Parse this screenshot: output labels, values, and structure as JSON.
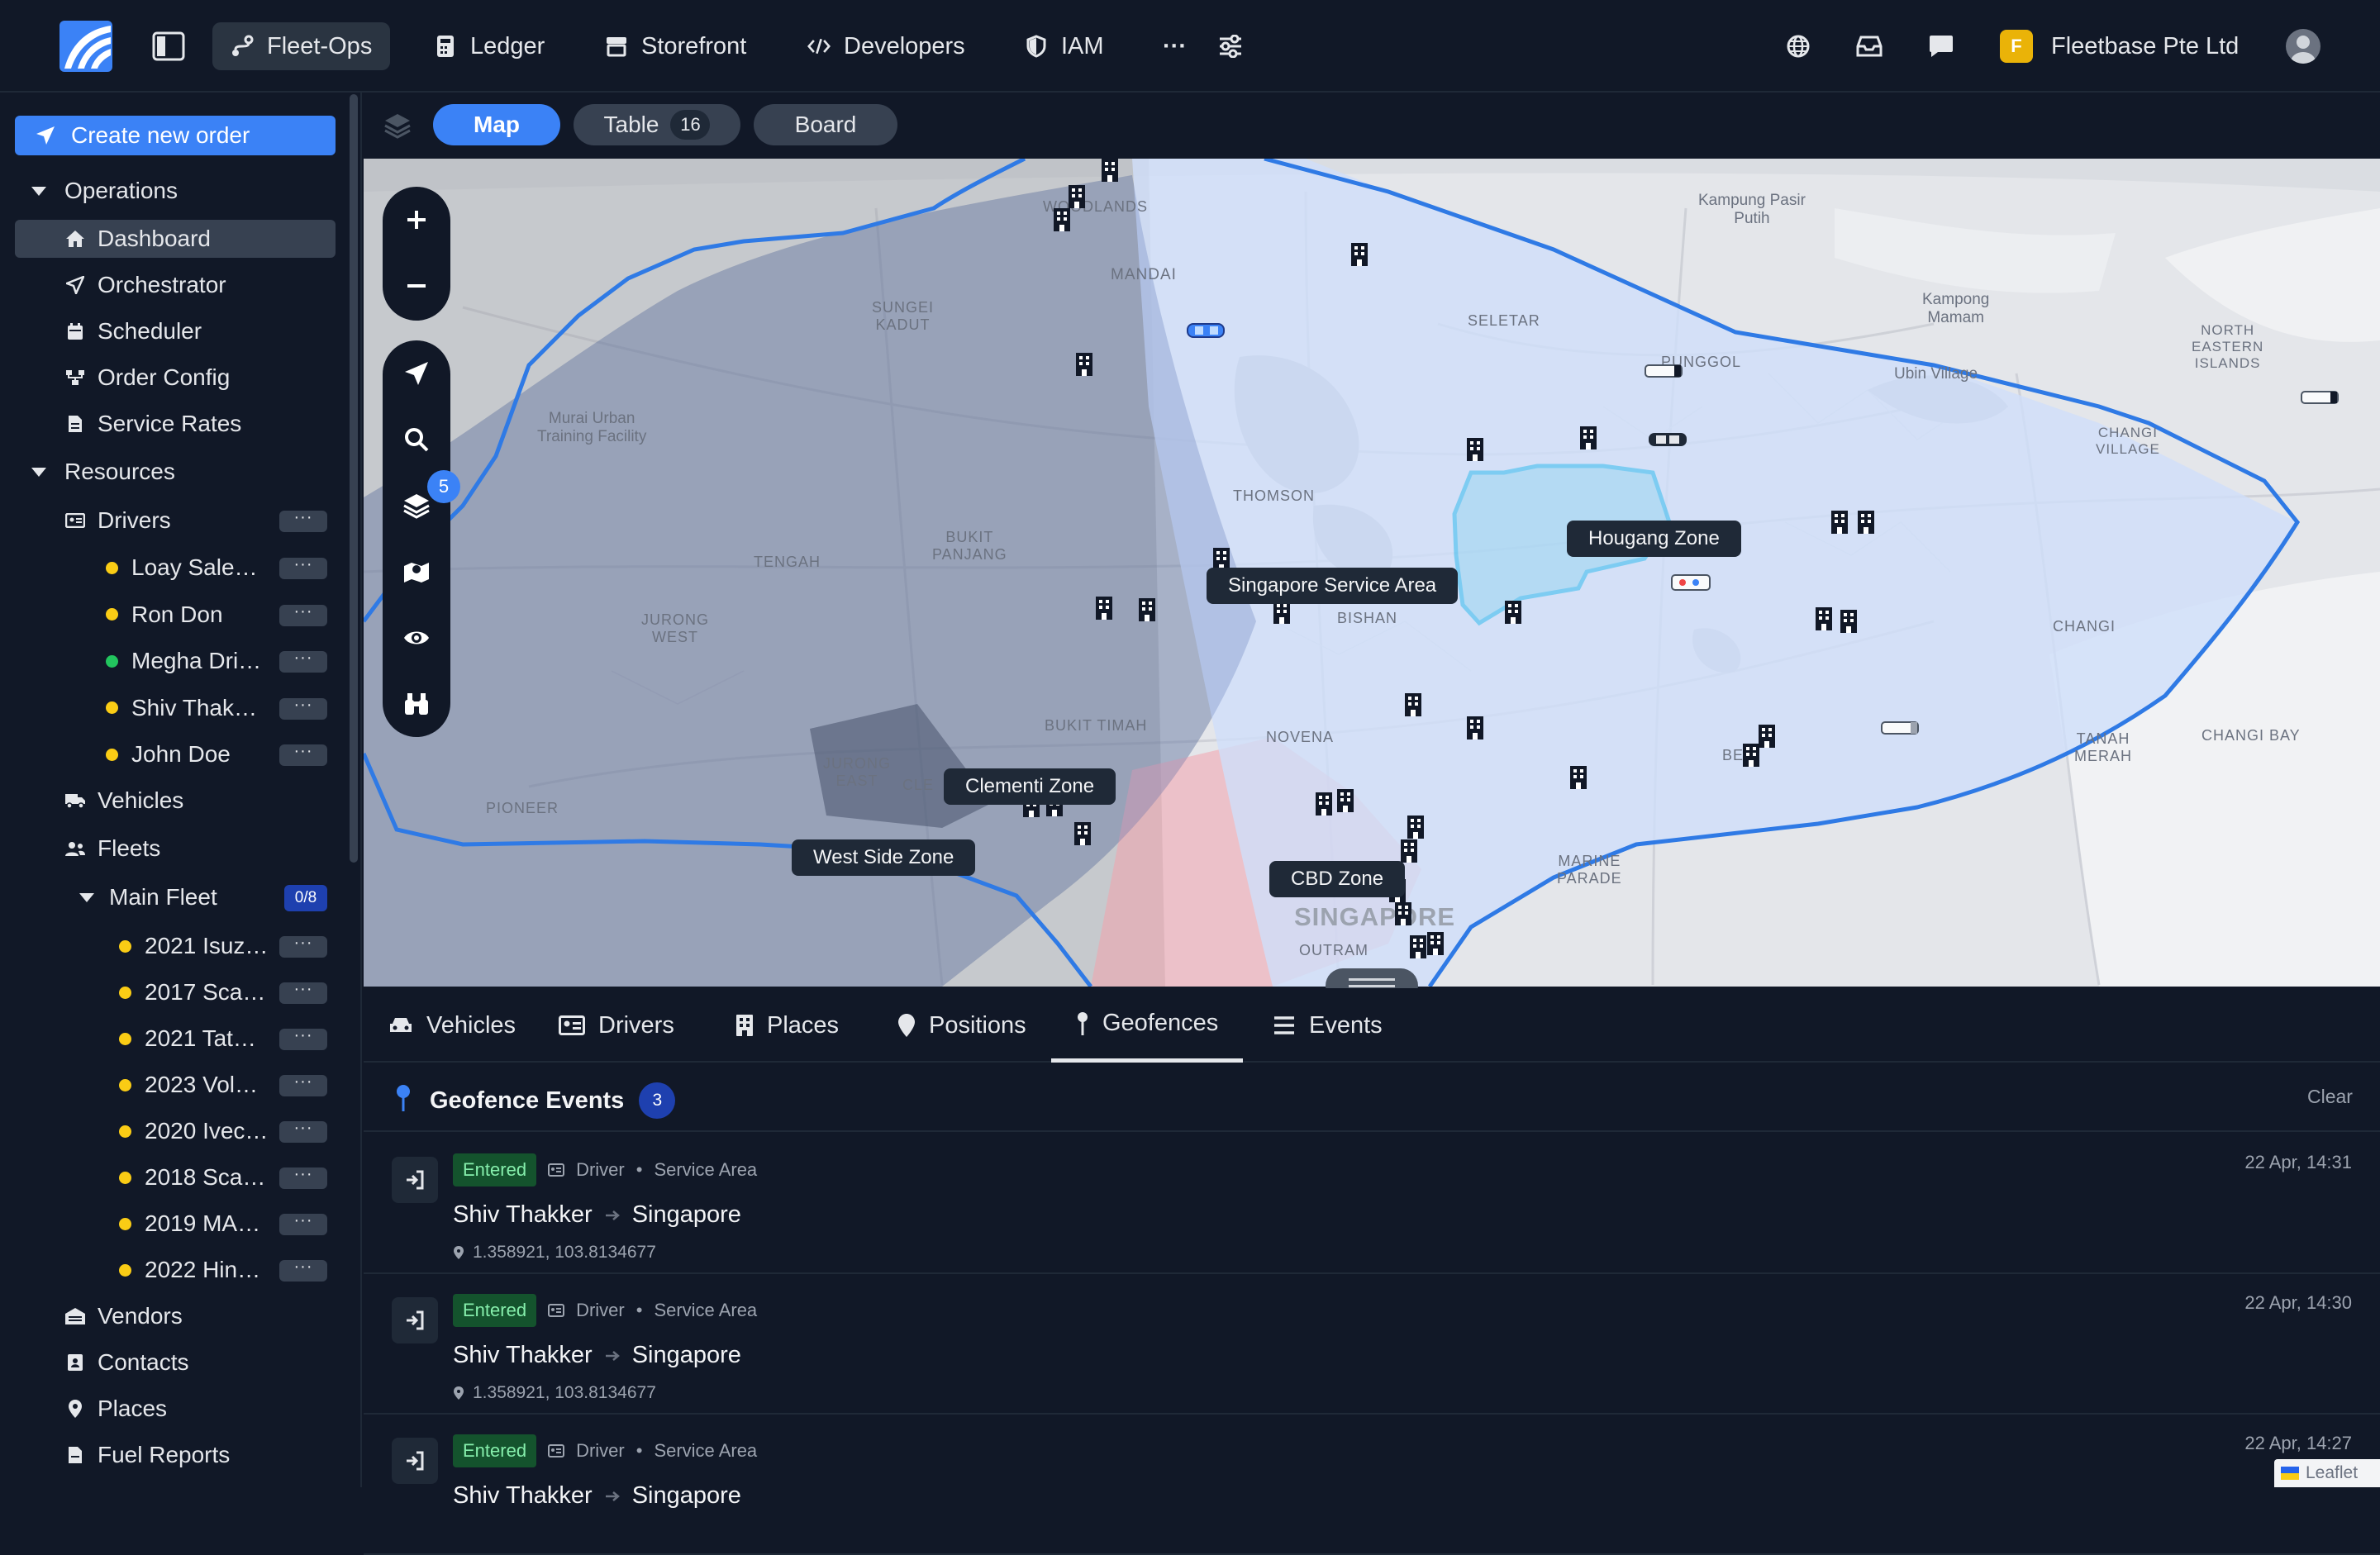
{
  "topnav": {
    "items": [
      {
        "label": "Fleet-Ops",
        "icon": "route-icon",
        "active": true
      },
      {
        "label": "Ledger",
        "icon": "calculator-icon"
      },
      {
        "label": "Storefront",
        "icon": "store-icon"
      },
      {
        "label": "Developers",
        "icon": "code-icon"
      },
      {
        "label": "IAM",
        "icon": "shield-icon"
      }
    ],
    "more_label": "···",
    "org_initial": "F",
    "org_name": "Fleetbase Pte Ltd"
  },
  "sidebar": {
    "create_label": "Create new order",
    "operations_label": "Operations",
    "operations": [
      {
        "label": "Dashboard",
        "active": true
      },
      {
        "label": "Orchestrator"
      },
      {
        "label": "Scheduler"
      },
      {
        "label": "Order Config"
      },
      {
        "label": "Service Rates"
      }
    ],
    "resources_label": "Resources",
    "drivers_label": "Drivers",
    "drivers": [
      {
        "label": "Loay Sale…",
        "status": "#facc15"
      },
      {
        "label": "Ron Don",
        "status": "#facc15"
      },
      {
        "label": "Megha Dri…",
        "status": "#22c55e"
      },
      {
        "label": "Shiv Thak…",
        "status": "#facc15"
      },
      {
        "label": "John Doe",
        "status": "#facc15"
      }
    ],
    "vehicles_label": "Vehicles",
    "fleets_label": "Fleets",
    "main_fleet_label": "Main Fleet",
    "main_fleet_badge": "0/8",
    "fleet_vehicles": [
      {
        "label": "2021 Isuz…",
        "status": "#facc15"
      },
      {
        "label": "2017 Sca…",
        "status": "#facc15"
      },
      {
        "label": "2021 Tat…",
        "status": "#facc15"
      },
      {
        "label": "2023 Vol…",
        "status": "#facc15"
      },
      {
        "label": "2020 Ivec…",
        "status": "#facc15"
      },
      {
        "label": "2018 Sca…",
        "status": "#facc15"
      },
      {
        "label": "2019 MA…",
        "status": "#facc15"
      },
      {
        "label": "2022 Hin…",
        "status": "#facc15"
      }
    ],
    "bottom": [
      {
        "label": "Vendors"
      },
      {
        "label": "Contacts"
      },
      {
        "label": "Places"
      },
      {
        "label": "Fuel Reports"
      }
    ],
    "more_label": "···"
  },
  "views": {
    "map": "Map",
    "table": "Table",
    "table_count": "16",
    "board": "Board"
  },
  "map": {
    "layer_count": "5",
    "zones": [
      "Singapore Service Area",
      "Hougang Zone",
      "Clementi Zone",
      "West Side Zone",
      "CBD Zone"
    ],
    "place_labels": {
      "mandai": "MANDAI",
      "sungei_kadut_1": "SUNGEI",
      "sungei_kadut_2": "KADUT",
      "woodlands": "WOODLANDS",
      "seletar": "SELETAR",
      "punggol": "PUNGGOL",
      "kampung_pasir_1": "Kampung Pasir",
      "kampung_pasir_2": "Putih",
      "kampong_mamam_1": "Kampong",
      "kampong_mamam_2": "Mamam",
      "ubin": "Ubin Village",
      "ne_islands_1": "NORTH",
      "ne_islands_2": "EASTERN",
      "ne_islands_3": "ISLANDS",
      "changi_village_1": "CHANGI",
      "changi_village_2": "VILLAGE",
      "murai_1": "Murai Urban",
      "murai_2": "Training Facility",
      "thomson": "THOMSON",
      "tengah": "TENGAH",
      "bukit_panjang_1": "BUKIT",
      "bukit_panjang_2": "PANJANG",
      "bishan": "BISHAN",
      "jurong_west_1": "JURONG",
      "jurong_west_2": "WEST",
      "bukit_timah": "BUKIT TIMAH",
      "novena": "NOVENA",
      "jurong_east_1": "JURONG",
      "jurong_east_2": "EAST",
      "clementi": "CLE",
      "pioneer": "PIONEER",
      "marine_parade_1": "MARINE",
      "marine_parade_2": "PARADE",
      "singapore": "SINGAPORE",
      "outram": "OUTRAM",
      "changi": "CHANGI",
      "changi_bay": "CHANGI BAY",
      "tanah_merah_1": "TANAH",
      "tanah_merah_2": "MERAH",
      "bedok": "BE"
    }
  },
  "tabs": [
    {
      "label": "Vehicles",
      "icon": "car-icon"
    },
    {
      "label": "Drivers",
      "icon": "id-card-icon"
    },
    {
      "label": "Places",
      "icon": "building-icon"
    },
    {
      "label": "Positions",
      "icon": "map-pin-icon"
    },
    {
      "label": "Geofences",
      "icon": "pin-icon",
      "active": true
    },
    {
      "label": "Events",
      "icon": "list-icon"
    }
  ],
  "geofence_events": {
    "title": "Geofence Events",
    "count": "3",
    "clear_label": "Clear",
    "events": [
      {
        "status": "Entered",
        "type": "Driver",
        "sep": "•",
        "zone_type": "Service Area",
        "subject": "Shiv Thakker",
        "zone": "Singapore",
        "coords": "1.358921, 103.8134677",
        "time": "22 Apr, 14:31"
      },
      {
        "status": "Entered",
        "type": "Driver",
        "sep": "•",
        "zone_type": "Service Area",
        "subject": "Shiv Thakker",
        "zone": "Singapore",
        "coords": "1.358921, 103.8134677",
        "time": "22 Apr, 14:30"
      },
      {
        "status": "Entered",
        "type": "Driver",
        "sep": "•",
        "zone_type": "Service Area",
        "subject": "Shiv Thakker",
        "zone": "Singapore",
        "coords": "",
        "time": "22 Apr, 14:27"
      }
    ]
  },
  "attribution": "Leaflet",
  "colors": {
    "accent": "#3b82f6",
    "background": "#111827",
    "panel": "#1f2937",
    "entered_bg": "#14532d",
    "entered_text": "#86efac",
    "geofence_blue": "#2f7ae5",
    "hougang_cyan": "#16b5ee",
    "cbd_red": "#f3a3ad"
  }
}
